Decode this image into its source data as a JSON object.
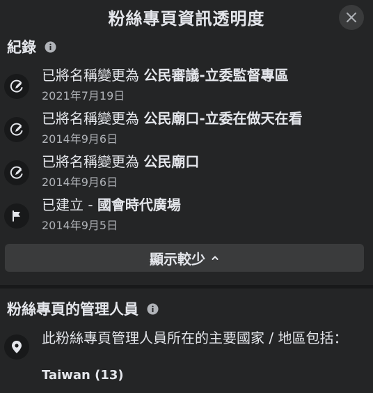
{
  "header": {
    "title": "粉絲專頁資訊透明度",
    "close_icon": "close-icon"
  },
  "history": {
    "title": "紀錄",
    "info_icon": "info-icon",
    "items": [
      {
        "icon": "edit-name-icon",
        "prefix": "已將名稱變更為 ",
        "name": "公民審議-立委監督專區",
        "date": "2021年7月19日"
      },
      {
        "icon": "edit-name-icon",
        "prefix": "已將名稱變更為 ",
        "name": "公民廟口-立委在做天在看",
        "date": "2014年9月6日"
      },
      {
        "icon": "edit-name-icon",
        "prefix": "已將名稱變更為 ",
        "name": "公民廟口",
        "date": "2014年9月6日"
      },
      {
        "icon": "flag-icon",
        "prefix": "已建立 - ",
        "name": "國會時代廣場",
        "date": "2014年9月5日"
      }
    ],
    "show_less_label": "顯示較少"
  },
  "admins": {
    "title": "粉絲專頁的管理人員",
    "info_icon": "info-icon",
    "icon": "location-pin-icon",
    "description": "此粉絲專頁管理人員所在的主要國家 / 地區包括：",
    "country": "Taiwan (13)"
  },
  "colors": {
    "background": "#242526",
    "surface": "#3a3b3c",
    "text_primary": "#e4e6eb",
    "text_secondary": "#b0b3b8"
  }
}
